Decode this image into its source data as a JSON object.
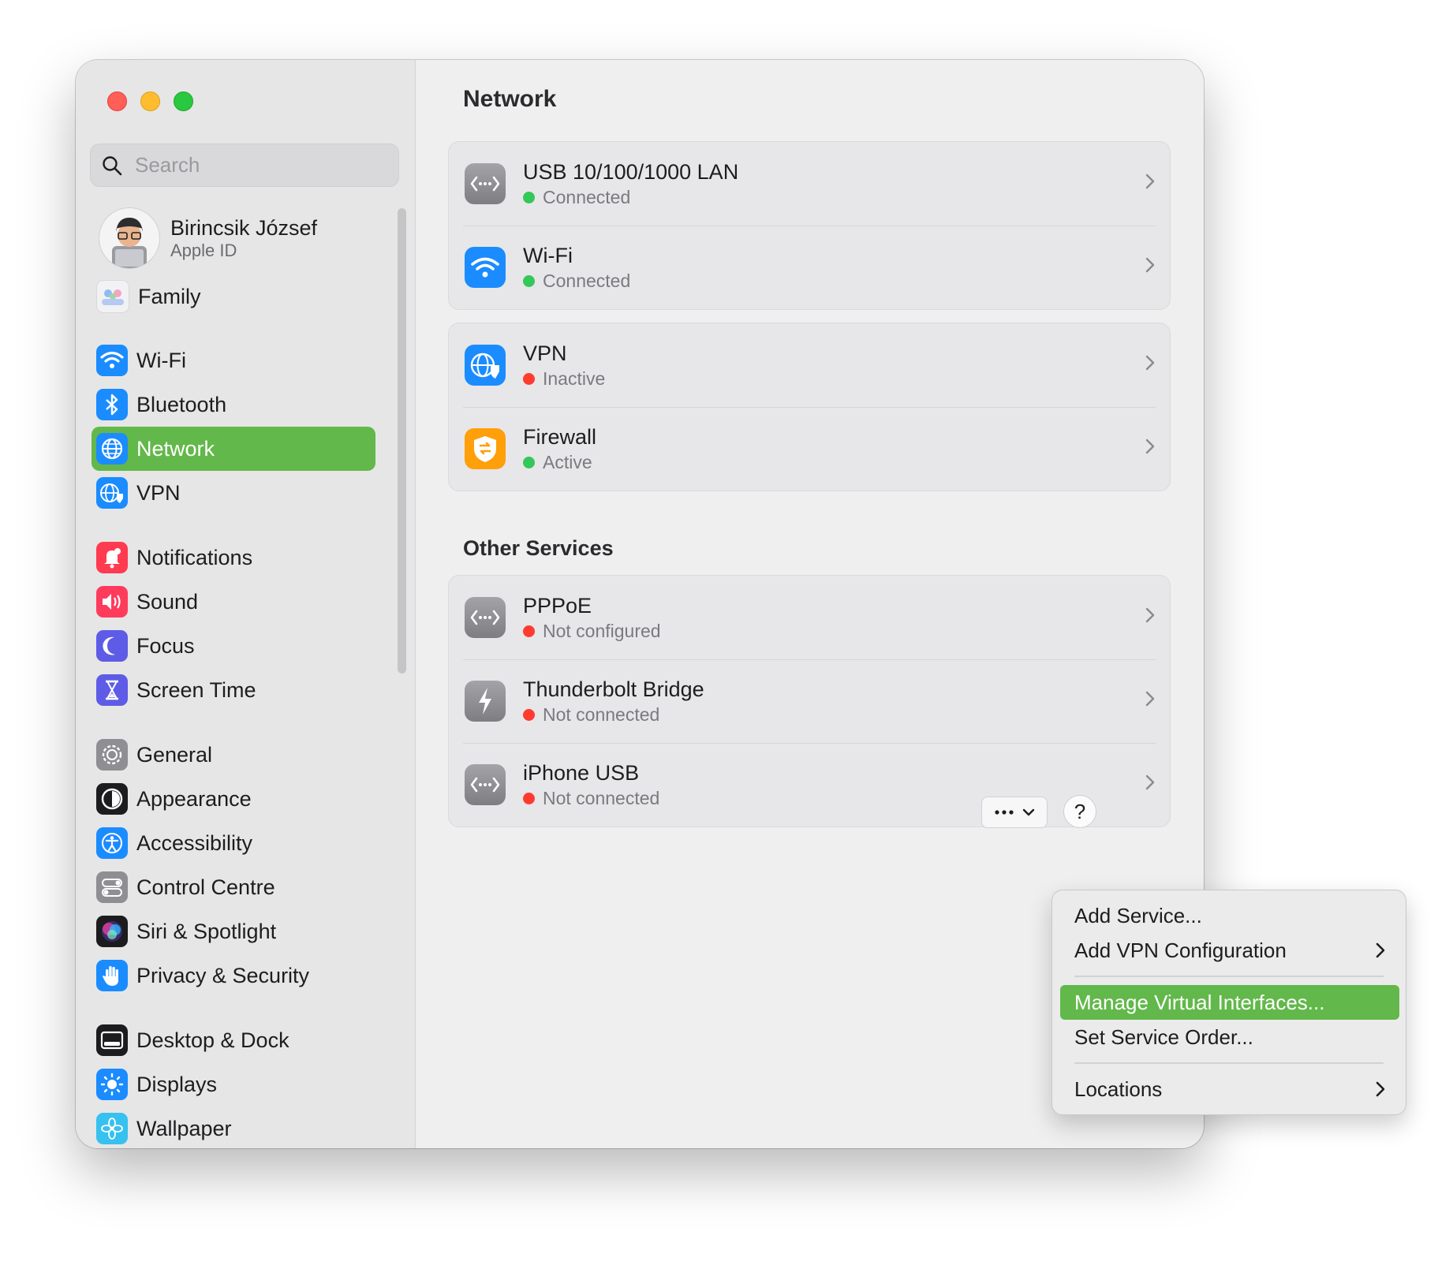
{
  "search": {
    "placeholder": "Search"
  },
  "profile": {
    "name": "Birincsik József",
    "subtitle": "Apple ID"
  },
  "sidebar": {
    "items": [
      {
        "label": "Family"
      },
      {
        "label": "Wi-Fi"
      },
      {
        "label": "Bluetooth"
      },
      {
        "label": "Network"
      },
      {
        "label": "VPN"
      },
      {
        "label": "Notifications"
      },
      {
        "label": "Sound"
      },
      {
        "label": "Focus"
      },
      {
        "label": "Screen Time"
      },
      {
        "label": "General"
      },
      {
        "label": "Appearance"
      },
      {
        "label": "Accessibility"
      },
      {
        "label": "Control Centre"
      },
      {
        "label": "Siri & Spotlight"
      },
      {
        "label": "Privacy & Security"
      },
      {
        "label": "Desktop & Dock"
      },
      {
        "label": "Displays"
      },
      {
        "label": "Wallpaper"
      }
    ],
    "selected": "Network"
  },
  "main": {
    "title": "Network",
    "services": [
      {
        "name": "USB 10/100/1000 LAN",
        "status": "Connected",
        "status_color": "#34c759"
      },
      {
        "name": "Wi-Fi",
        "status": "Connected",
        "status_color": "#34c759"
      },
      {
        "name": "VPN",
        "status": "Inactive",
        "status_color": "#ff3b30"
      },
      {
        "name": "Firewall",
        "status": "Active",
        "status_color": "#34c759"
      }
    ],
    "other_title": "Other Services",
    "other_services": [
      {
        "name": "PPPoE",
        "status": "Not configured",
        "status_color": "#ff3b30"
      },
      {
        "name": "Thunderbolt Bridge",
        "status": "Not connected",
        "status_color": "#ff3b30"
      },
      {
        "name": "iPhone USB",
        "status": "Not connected",
        "status_color": "#ff3b30"
      }
    ],
    "help_label": "?"
  },
  "menu": {
    "items": [
      {
        "label": "Add Service..."
      },
      {
        "label": "Add VPN Configuration",
        "submenu": true
      },
      {
        "label": "Manage Virtual Interfaces...",
        "highlighted": true
      },
      {
        "label": "Set Service Order..."
      },
      {
        "label": "Locations",
        "submenu": true
      }
    ]
  },
  "colors": {
    "accent": "#62b84a",
    "connected": "#34c759",
    "disconnected": "#ff3b30"
  }
}
